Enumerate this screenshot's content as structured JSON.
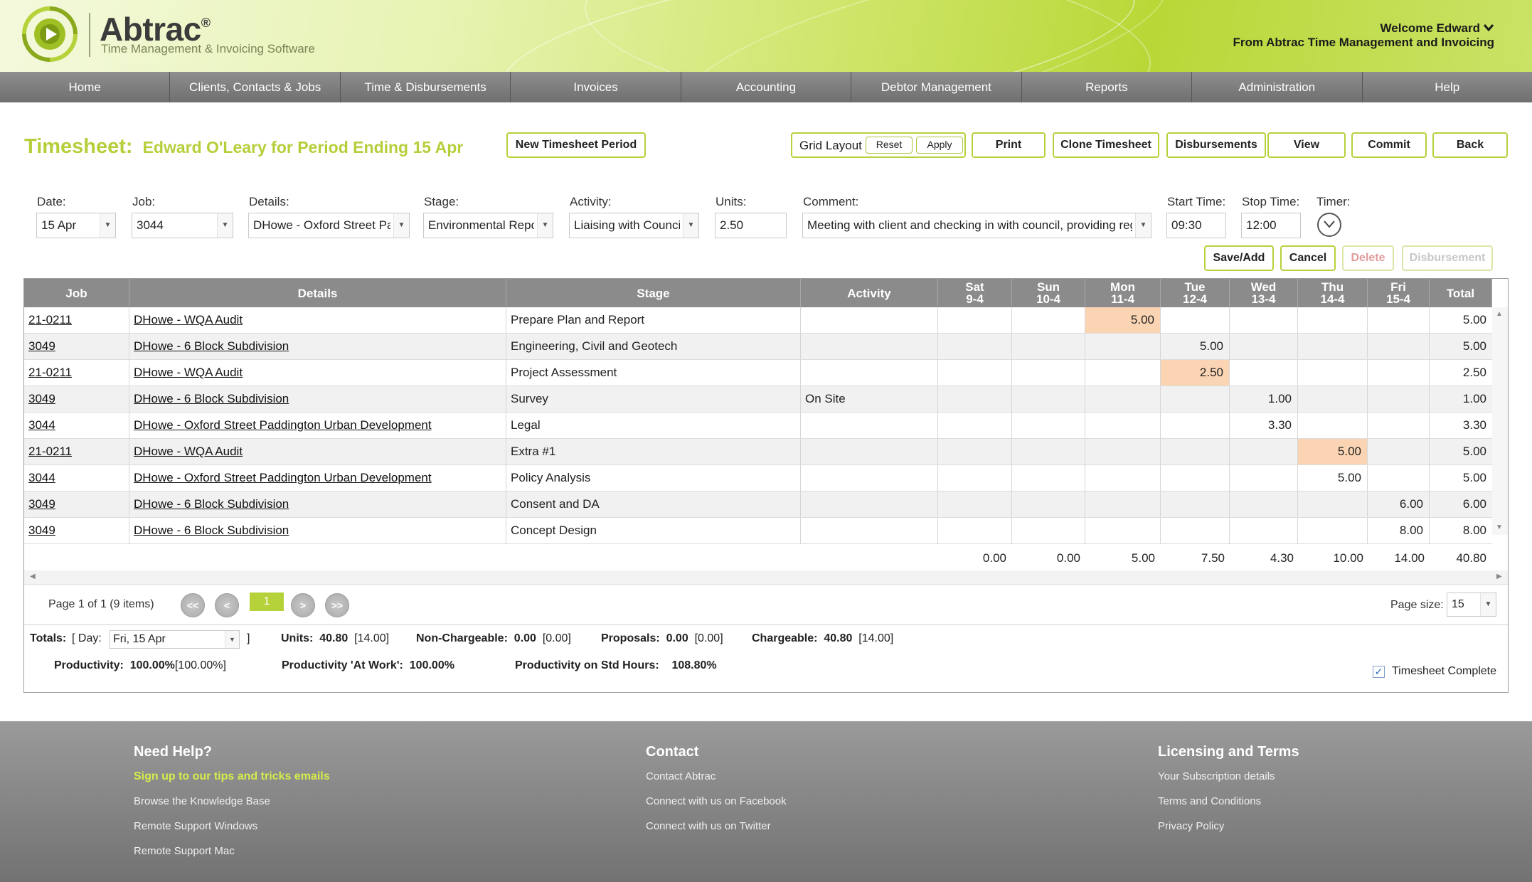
{
  "header": {
    "brand": "Abtrac",
    "reg": "®",
    "tagline": "Time Management & Invoicing Software",
    "welcome": "Welcome Edward",
    "from": "From Abtrac Time Management and Invoicing",
    "accent_color": "#b5cf3b"
  },
  "nav": [
    "Home",
    "Clients, Contacts & Jobs",
    "Time & Disbursements",
    "Invoices",
    "Accounting",
    "Debtor Management",
    "Reports",
    "Administration",
    "Help"
  ],
  "title": {
    "label": "Timesheet:",
    "subtitle": "Edward O'Leary for Period Ending 15 Apr"
  },
  "toolbar": {
    "new_period": "New Timesheet Period",
    "grid_layout": "Grid Layout",
    "reset": "Reset",
    "apply": "Apply",
    "print": "Print",
    "clone": "Clone Timesheet",
    "disbursements": "Disbursements",
    "view": "View",
    "commit": "Commit",
    "back": "Back"
  },
  "form": {
    "date_label": "Date:",
    "date": "15 Apr",
    "job_label": "Job:",
    "job": "3044",
    "details_label": "Details:",
    "details": "DHowe - Oxford Street Paddington Urban Development",
    "stage_label": "Stage:",
    "stage": "Environmental Report",
    "activity_label": "Activity:",
    "activity": "Liaising with Council",
    "units_label": "Units:",
    "units": "2.50",
    "comment_label": "Comment:",
    "comment": "Meeting with client and checking in with council, providing regular updates",
    "start_label": "Start Time:",
    "start": "09:30",
    "stop_label": "Stop Time:",
    "stop": "12:00",
    "timer_label": "Timer:",
    "save_add": "Save/Add",
    "cancel": "Cancel",
    "delete": "Delete",
    "disbursement": "Disbursement"
  },
  "grid": {
    "headers": {
      "job": "Job",
      "details": "Details",
      "stage": "Stage",
      "activity": "Activity",
      "sat": "Sat\n9-4",
      "sun": "Sun\n10-4",
      "mon": "Mon\n11-4",
      "tue": "Tue\n12-4",
      "wed": "Wed\n13-4",
      "thu": "Thu\n14-4",
      "fri": "Fri\n15-4",
      "total": "Total"
    },
    "rows": [
      {
        "job": "21-0211",
        "details": "DHowe - WQA Audit",
        "stage": "Prepare Plan and Report",
        "activity": "",
        "days": [
          "",
          "",
          "5.00",
          "",
          "",
          "",
          ""
        ],
        "total": "5.00"
      },
      {
        "job": "3049",
        "details": "DHowe - 6 Block Subdivision",
        "stage": "Engineering, Civil and Geotech",
        "activity": "",
        "days": [
          "",
          "",
          "",
          "5.00",
          "",
          "",
          ""
        ],
        "total": "5.00"
      },
      {
        "job": "21-0211",
        "details": "DHowe - WQA Audit",
        "stage": "Project Assessment",
        "activity": "",
        "days": [
          "",
          "",
          "",
          "2.50",
          "",
          "",
          ""
        ],
        "total": "2.50"
      },
      {
        "job": "3049",
        "details": "DHowe - 6 Block Subdivision",
        "stage": "Survey",
        "activity": "On Site",
        "days": [
          "",
          "",
          "",
          "",
          "1.00",
          "",
          ""
        ],
        "total": "1.00"
      },
      {
        "job": "3044",
        "details": "DHowe - Oxford Street Paddington Urban Development",
        "stage": "Legal",
        "activity": "",
        "days": [
          "",
          "",
          "",
          "",
          "3.30",
          "",
          ""
        ],
        "total": "3.30"
      },
      {
        "job": "21-0211",
        "details": "DHowe - WQA Audit",
        "stage": "Extra #1",
        "activity": "",
        "days": [
          "",
          "",
          "",
          "",
          "",
          "5.00",
          ""
        ],
        "total": "5.00"
      },
      {
        "job": "3044",
        "details": "DHowe - Oxford Street Paddington Urban Development",
        "stage": "Policy Analysis",
        "activity": "",
        "days": [
          "",
          "",
          "",
          "",
          "",
          "5.00",
          ""
        ],
        "total": "5.00"
      },
      {
        "job": "3049",
        "details": "DHowe - 6 Block Subdivision",
        "stage": "Consent and DA",
        "activity": "",
        "days": [
          "",
          "",
          "",
          "",
          "",
          "",
          "6.00"
        ],
        "total": "6.00"
      },
      {
        "job": "3049",
        "details": "DHowe - 6 Block Subdivision",
        "stage": "Concept Design",
        "activity": "",
        "days": [
          "",
          "",
          "",
          "",
          "",
          "",
          "8.00"
        ],
        "total": "8.00"
      }
    ],
    "highlight_color": "#fbd5b3",
    "column_totals": [
      "0.00",
      "0.00",
      "5.00",
      "7.50",
      "4.30",
      "10.00",
      "14.00",
      "40.80"
    ]
  },
  "pager": {
    "info": "Page 1 of 1 (9 items)",
    "first": "<<",
    "prev": "<",
    "current": "1",
    "next": ">",
    "last": ">>",
    "size_label": "Page size:",
    "size": "15"
  },
  "totals": {
    "label": "Totals:",
    "day_prefix": "[ Day:",
    "day_value": "Fri, 15 Apr",
    "day_suffix": "]",
    "units_label": "Units:",
    "units": "40.80",
    "units_b": "[14.00]",
    "nonchg_label": "Non-Chargeable:",
    "nonchg": "0.00",
    "nonchg_b": "[0.00]",
    "prop_label": "Proposals:",
    "prop": "0.00",
    "prop_b": "[0.00]",
    "chg_label": "Chargeable:",
    "chg": "40.80",
    "chg_b": "[14.00]",
    "prod_label": "Productivity:",
    "prod": "100.00%",
    "prod_b": "[100.00%]",
    "prod_work_label": "Productivity 'At Work':",
    "prod_work": "100.00%",
    "prod_std_label": "Productivity on Std Hours:",
    "prod_std": "108.80%",
    "complete_label": "Timesheet Complete"
  },
  "footer": {
    "help": {
      "title": "Need Help?",
      "links": [
        "Sign up to our tips and tricks emails",
        "Browse the Knowledge Base",
        "Remote Support Windows",
        "Remote Support Mac"
      ]
    },
    "contact": {
      "title": "Contact",
      "links": [
        "Contact Abtrac",
        "Connect with us on Facebook",
        "Connect with us on Twitter"
      ]
    },
    "licensing": {
      "title": "Licensing and Terms",
      "links": [
        "Your Subscription details",
        "Terms and Conditions",
        "Privacy Policy"
      ]
    }
  }
}
